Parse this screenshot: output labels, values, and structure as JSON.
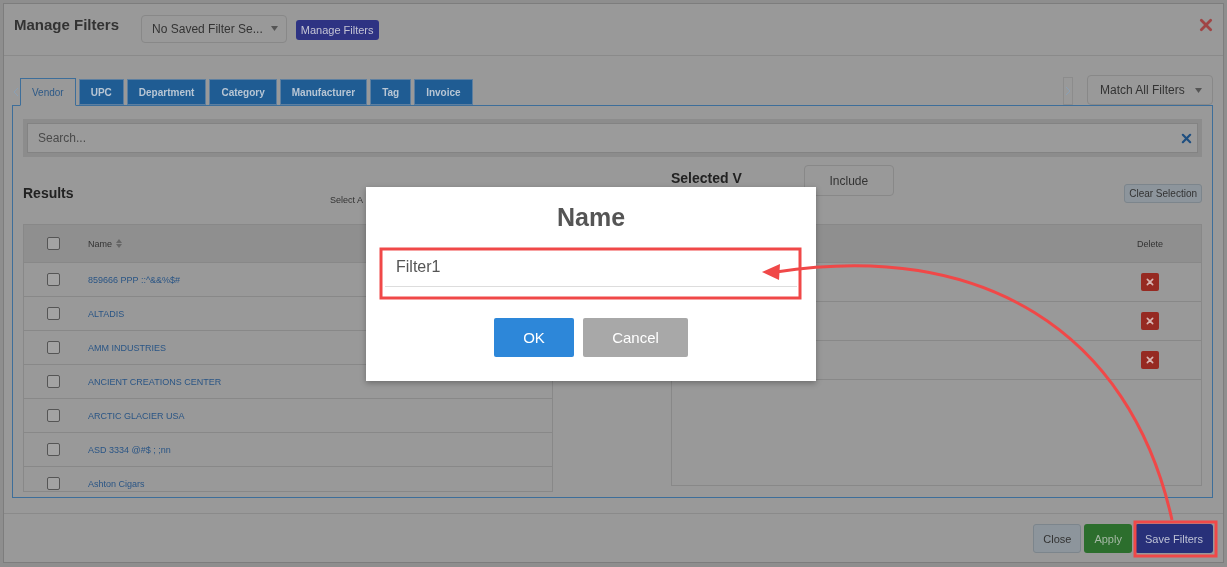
{
  "window": {
    "title": "Manage Filters",
    "saved_filter_select": {
      "value": "No Saved Filter Se..."
    },
    "manage_filters_button": "Manage Filters"
  },
  "tabs": [
    {
      "label": "Vendor",
      "selected": true
    },
    {
      "label": "UPC",
      "selected": false
    },
    {
      "label": "Department",
      "selected": false
    },
    {
      "label": "Category",
      "selected": false
    },
    {
      "label": "Manufacturer",
      "selected": false
    },
    {
      "label": "Tag",
      "selected": false
    },
    {
      "label": "Invoice",
      "selected": false
    }
  ],
  "match_select": {
    "value": "Match All Filters"
  },
  "search": {
    "placeholder": "Search..."
  },
  "results": {
    "title": "Results",
    "select_all_link": "Select A",
    "header_checked": false,
    "columns": [
      "Name"
    ],
    "rows": [
      {
        "name": "859666 PPP ::^&&%$#",
        "checked": false
      },
      {
        "name": "ALTADIS",
        "checked": false
      },
      {
        "name": "AMM INDUSTRIES",
        "checked": false
      },
      {
        "name": "ANCIENT CREATIONS CENTER",
        "checked": false
      },
      {
        "name": "ARCTIC GLACIER USA",
        "checked": false
      },
      {
        "name": "ASD 3334 @#$ ; ;nn",
        "checked": false
      },
      {
        "name": "Ashton Cigars",
        "checked": false
      }
    ]
  },
  "selected_panel": {
    "title": "Selected V",
    "mode_button": "Include",
    "clear_button": "Clear Selection",
    "columns": [
      "Delete"
    ],
    "rows": [
      {
        "kind": "delete"
      },
      {
        "kind": "delete"
      },
      {
        "kind": "delete"
      }
    ]
  },
  "name_dialog": {
    "title": "Name",
    "value": "Filter1",
    "buttons": [
      {
        "label": "OK",
        "kind": "primary"
      },
      {
        "label": "Cancel",
        "kind": "secondary"
      }
    ]
  },
  "footer_buttons": [
    {
      "label": "Close",
      "kind": "default"
    },
    {
      "label": "Apply",
      "kind": "success"
    },
    {
      "label": "Save Filters",
      "kind": "primary"
    }
  ]
}
